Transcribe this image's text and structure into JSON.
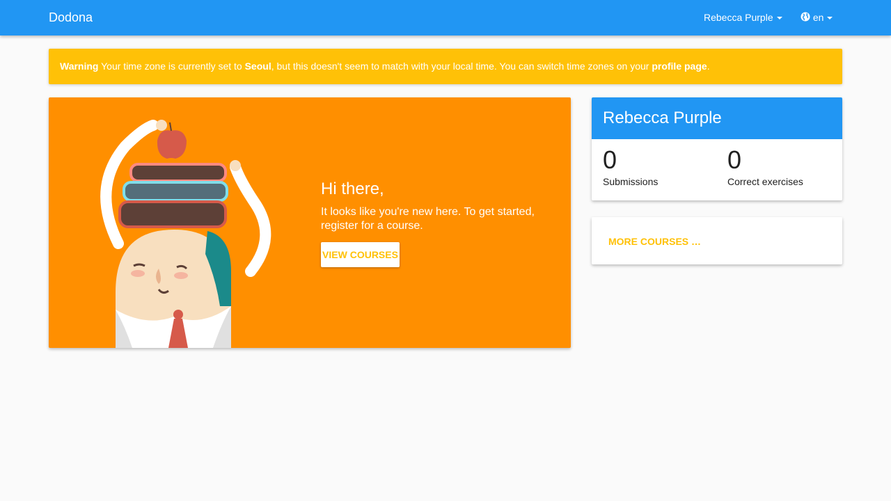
{
  "navbar": {
    "brand": "Dodona",
    "user_menu": "Rebecca Purple",
    "language": "en"
  },
  "warning": {
    "label": "Warning",
    "text_1": " Your time zone is currently set to ",
    "timezone": "Seoul",
    "text_2": ", but this doesn't seem to match with your local time. You can switch time zones on your ",
    "link": "profile page",
    "text_3": "."
  },
  "hero": {
    "heading": "Hi there,",
    "text": "It looks like you're new here. To get started, register for a course.",
    "button": "VIEW COURSES"
  },
  "user_card": {
    "name": "Rebecca Purple",
    "stats": [
      {
        "value": "0",
        "label": "Submissions"
      },
      {
        "value": "0",
        "label": "Correct exercises"
      }
    ]
  },
  "courses_card": {
    "more_link": "MORE COURSES …"
  },
  "colors": {
    "primary": "#2196f3",
    "warning": "#ffc107",
    "hero": "#ff8f00"
  },
  "icons": {
    "language": "globe-icon",
    "dropdown": "caret-down-icon"
  }
}
